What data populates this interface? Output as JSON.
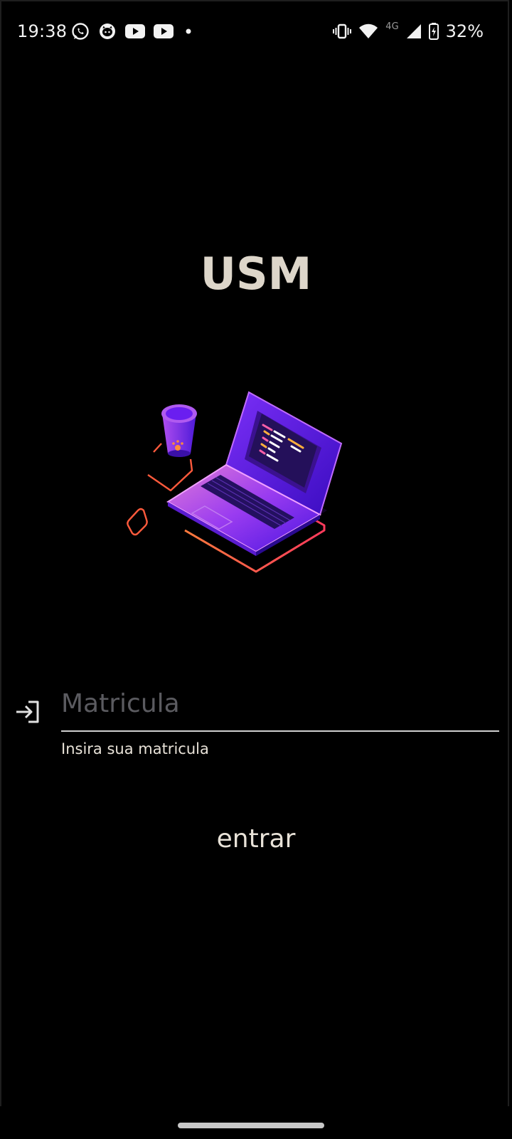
{
  "status_bar": {
    "time": "19:38",
    "notification_icons": [
      "whatsapp-icon",
      "github-icon",
      "youtube-icon",
      "youtube-icon",
      "dot-icon"
    ],
    "system_icons": [
      "vibrate-icon",
      "wifi-icon",
      "4g-icon",
      "signal-icon",
      "battery-charging-icon"
    ],
    "network_label": "4G",
    "battery": "32%"
  },
  "app": {
    "title": "USM"
  },
  "login": {
    "field_icon": "login-arrow-icon",
    "placeholder": "Matricula",
    "value": "",
    "helper": "Insira sua matricula",
    "submit_label": "entrar"
  },
  "colors": {
    "background": "#000000",
    "text": "#e8e2d8",
    "placeholder": "#5b5b60",
    "accent_purple": "#6a1ef0",
    "accent_orange": "#ff5a3c"
  }
}
